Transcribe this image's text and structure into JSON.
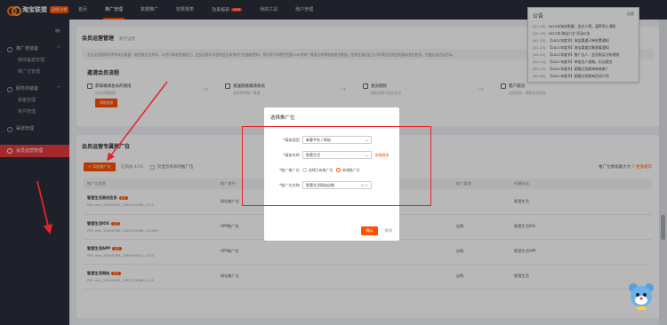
{
  "header": {
    "logo_text": "淘宝联盟",
    "logo_badge": "返佣·分销",
    "nav": [
      {
        "label": "首页",
        "active": false,
        "badge": ""
      },
      {
        "label": "推广管理",
        "active": true,
        "badge": ""
      },
      {
        "label": "数据推广",
        "active": false,
        "badge": ""
      },
      {
        "label": "效果报表",
        "active": false,
        "badge": ""
      },
      {
        "label": "效果报表",
        "active": false,
        "badge": "NEW"
      },
      {
        "label": "我的工具",
        "active": false,
        "badge": ""
      },
      {
        "label": "账户管理",
        "active": false,
        "badge": ""
      }
    ]
  },
  "sidebar": {
    "groups": [
      {
        "label": "推广者装备",
        "items": [
          "媒体备案管理",
          "推广位管理"
        ]
      },
      {
        "label": "服务商装备",
        "items": [
          "装备管理",
          "条件管理"
        ]
      },
      {
        "label": "渠道管理",
        "items": []
      }
    ],
    "active_label": "会员运营管理"
  },
  "main": {
    "card1_title": "会员运营管理",
    "card1_sub": "新手运营",
    "notice": "会员运营管理可提供淘宝联盟一套完整会员系统，以进行精准营销能力，会员运营可对您的会员体系进行完整配置的，我们将为你提供完整CDP的推广数据及效果数据相关数据，您将会通过此方式获得会员收益的整体变化趋势，加速达成活动目标。",
    "steps_title": "邀请会员流程",
    "steps": [
      {
        "title": "获取邀请会员的链接",
        "desc": "点击获得链接",
        "button": "获取链接"
      },
      {
        "title": "发送链接邀请会员",
        "desc": "支持多种推广渠道",
        "button": ""
      },
      {
        "title": "会员授权",
        "desc": "授权后即可成为会员",
        "button": ""
      },
      {
        "title": "客户成功",
        "desc": "会员成功，获取会员收益",
        "button": ""
      }
    ],
    "card2_title": "会员运营专属推广位",
    "add_button": "+ 添加推广位",
    "added_count": "已添加 4/70",
    "filter_label": "仅显示有效的推广位",
    "right_text": "推广位数据最大为",
    "right_link": "7 更多提示",
    "columns": [
      "推广位信息",
      "推广途径",
      "",
      "",
      "推广渠道",
      "所属网站"
    ],
    "rows": [
      {
        "name": "智营生活测试会员",
        "tag": "会员",
        "pid": "PID: mm_25040383_2182750388_1111",
        "channel": "网站推广位",
        "mid": "",
        "site": "智营生活"
      },
      {
        "name": "智营生活IOS",
        "tag": "会员",
        "pid": "PID: mm_25040383_2182750388_111069",
        "channel": "APP推广位",
        "mid": "自购",
        "site": "智营生活IOS"
      },
      {
        "name": "智营生活APP",
        "tag": "会员",
        "pid": "PID: mm_25040383_2189050401_1110",
        "channel": "APP推广位",
        "mid": "自购",
        "site": "智营生活APP"
      },
      {
        "name": "智营生活网站",
        "tag": "会员",
        "pid": "PID: mm_25040383_2182750388_1110",
        "channel": "网站推广位",
        "mid": "自购",
        "site": "智营生活"
      }
    ]
  },
  "announcement": {
    "title": "公告",
    "hide_label": "隐藏",
    "items": [
      {
        "date": "[01-28]",
        "text": "2020年淘宝联盟：会达人榜，速率到上通知"
      },
      {
        "date": "[01-19]",
        "text": "2021年'淘宝小主'活动公告"
      },
      {
        "date": "[01-13]",
        "text": "【2021年度节】淘宝渠道订单处置通知"
      },
      {
        "date": "[01-15]",
        "text": "【2021年度节】淘宝渠道文案查看通知"
      },
      {
        "date": "[01-15]",
        "text": "【2021年度节】推广达人：会员购买分析规则"
      },
      {
        "date": "[01-13]",
        "text": "【2021年度节】单张达人攻略，历达就业"
      },
      {
        "date": "[01-12]",
        "text": "【2021年度节】超级红包影响有效推广"
      },
      {
        "date": "[01-08]",
        "text": "【2021年度节】超级红包影响活动介绍"
      }
    ]
  },
  "modal": {
    "title": "选择推广位",
    "media_type_label": "*媒体类型",
    "media_type_value": "新客平台 / 网站",
    "media_name_label": "*媒体名称",
    "media_name_value": "智营生活",
    "create_link": "新增媒体",
    "ad_label": "*推广推广位",
    "radio_existing": "选择已有推广位",
    "radio_new": "新增推广位",
    "ad_name_label": "*推广位名称",
    "ad_name_value": "智营生活网站自购",
    "ad_name_count": "8/20",
    "ok": "确认",
    "cancel": "取消"
  },
  "colors": {
    "brand": "#ff5000",
    "sidebar_bg": "#2a2f3a",
    "active_red": "#e4393c",
    "annotation_red": "#e8212a"
  }
}
